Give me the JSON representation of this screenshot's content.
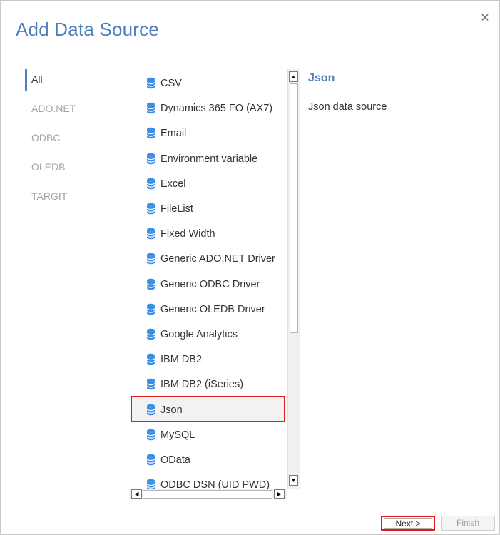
{
  "dialog": {
    "title": "Add Data Source",
    "close_glyph": "✕"
  },
  "categories": [
    {
      "label": "All",
      "active": true
    },
    {
      "label": "ADO.NET",
      "active": false
    },
    {
      "label": "ODBC",
      "active": false
    },
    {
      "label": "OLEDB",
      "active": false
    },
    {
      "label": "TARGIT",
      "active": false
    }
  ],
  "sources": [
    {
      "label": "CSV"
    },
    {
      "label": "Dynamics 365 FO (AX7)"
    },
    {
      "label": "Email"
    },
    {
      "label": "Environment variable"
    },
    {
      "label": "Excel"
    },
    {
      "label": "FileList"
    },
    {
      "label": "Fixed Width"
    },
    {
      "label": "Generic ADO.NET Driver"
    },
    {
      "label": "Generic ODBC Driver"
    },
    {
      "label": "Generic OLEDB Driver"
    },
    {
      "label": "Google Analytics"
    },
    {
      "label": "IBM DB2"
    },
    {
      "label": "IBM DB2 (iSeries)"
    },
    {
      "label": "Json",
      "selected": true
    },
    {
      "label": "MySQL"
    },
    {
      "label": "OData"
    },
    {
      "label": "ODBC DSN (UID PWD)"
    }
  ],
  "detail": {
    "title": "Json",
    "description": "Json data source"
  },
  "scroll": {
    "up": "▲",
    "down": "▼",
    "left": "◀",
    "right": "▶"
  },
  "footer": {
    "next_label": "Next >",
    "finish_label": "Finish"
  },
  "colors": {
    "accent": "#4f7fbd",
    "highlight": "#e11b1b",
    "icon": "#3a8ee6"
  },
  "icons": {
    "source_item": "database-icon",
    "close": "close-icon"
  }
}
